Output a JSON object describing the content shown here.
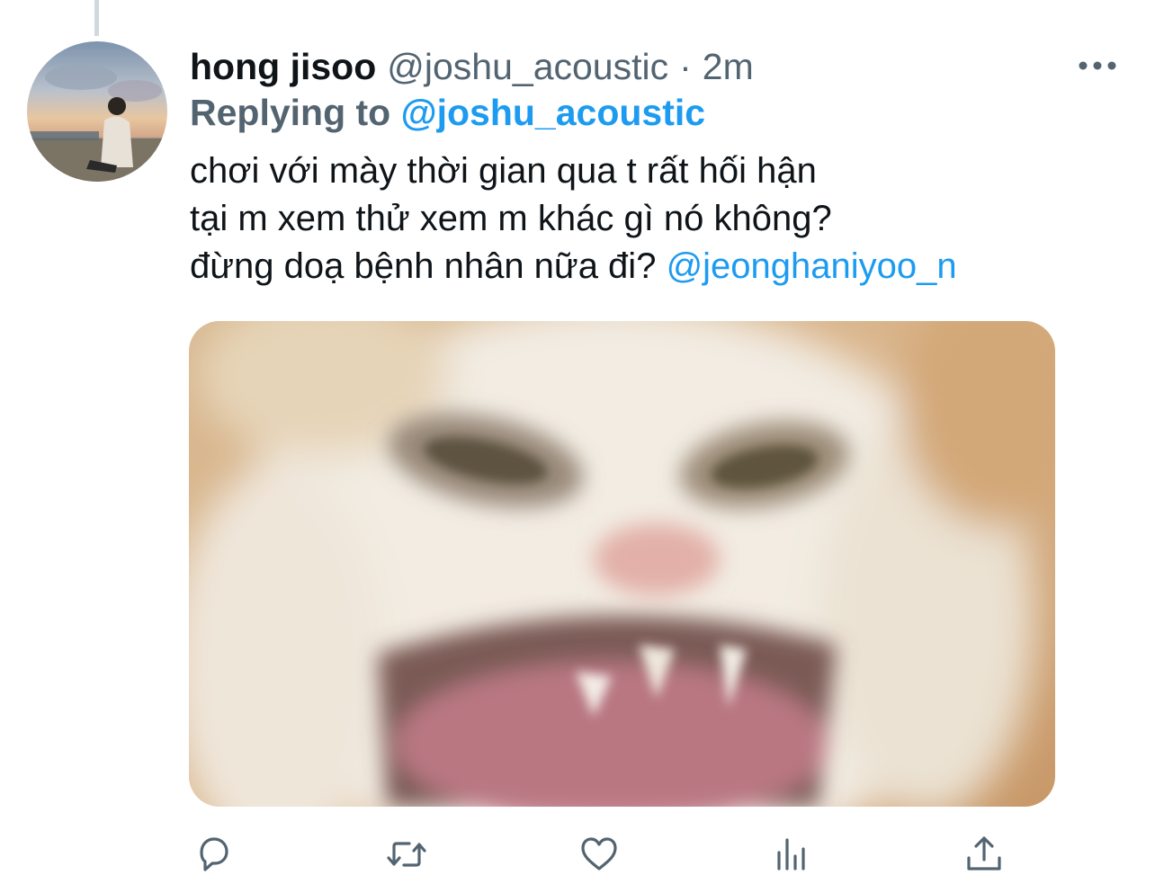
{
  "tweet": {
    "author_name": "hong jisoo",
    "author_handle": "@joshu_acoustic",
    "separator": "·",
    "timestamp": "2m",
    "replying_prefix": "Replying to",
    "replying_to": "@joshu_acoustic",
    "body_lines": [
      "chơi với mày thời gian qua t rất hối hận",
      "tại m xem thử xem m khác gì nó không?",
      "đừng doạ bệnh nhân nữa đi?"
    ],
    "body_mention": "@jeonghaniyoo_n"
  },
  "icons": {
    "more": "more-horizontal-icon",
    "reply": "reply-bubble-icon",
    "retweet": "retweet-icon",
    "like": "heart-icon",
    "analytics": "analytics-bar-icon",
    "share": "share-upload-icon"
  },
  "colors": {
    "accent": "#1d9bf0",
    "secondary_text": "#536471",
    "primary_text": "#0f1419",
    "thread_line": "#cfd9de"
  }
}
